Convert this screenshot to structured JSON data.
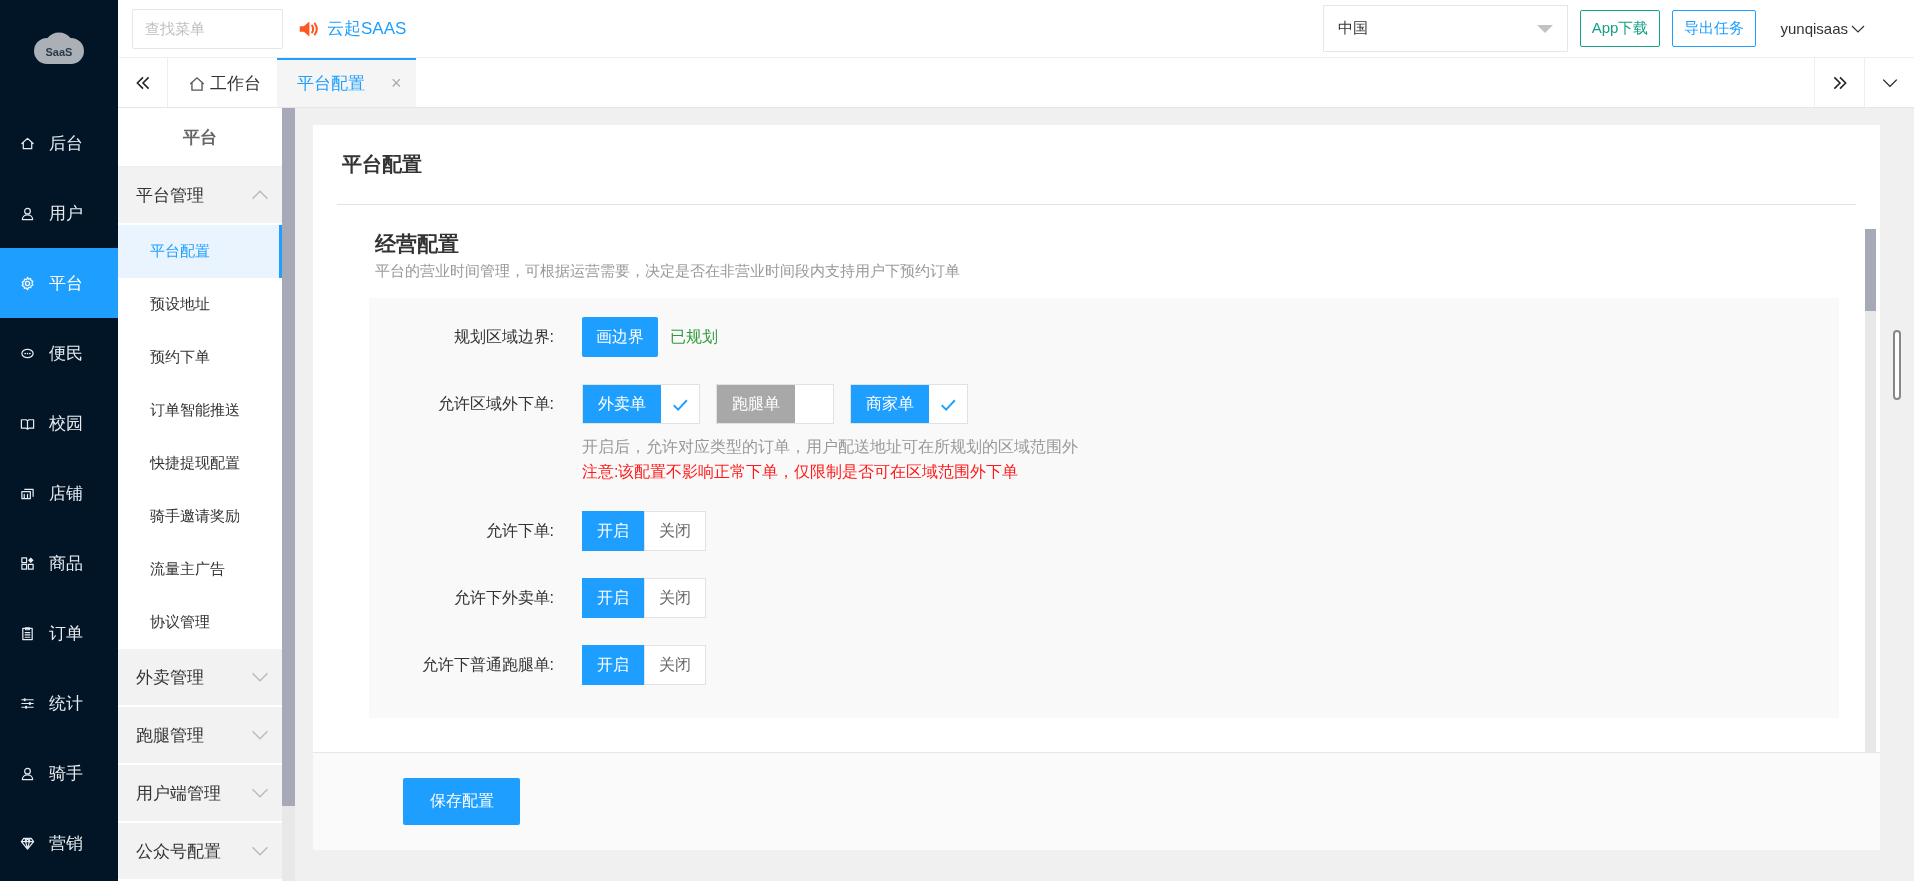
{
  "logo": {
    "text": "SaaS"
  },
  "nav": [
    {
      "label": "后台",
      "kind": "home",
      "selected": false
    },
    {
      "label": "用户",
      "kind": "user",
      "selected": false
    },
    {
      "label": "平台",
      "kind": "gear",
      "selected": true
    },
    {
      "label": "便民",
      "kind": "chat",
      "selected": false
    },
    {
      "label": "校园",
      "kind": "book",
      "selected": false
    },
    {
      "label": "店铺",
      "kind": "shop",
      "selected": false
    },
    {
      "label": "商品",
      "kind": "grid",
      "selected": false
    },
    {
      "label": "订单",
      "kind": "clipboard",
      "selected": false
    },
    {
      "label": "统计",
      "kind": "sliders",
      "selected": false
    },
    {
      "label": "骑手",
      "kind": "user",
      "selected": false
    },
    {
      "label": "营销",
      "kind": "diamond",
      "selected": false
    }
  ],
  "search": {
    "placeholder": "查找菜单"
  },
  "notice": "云起SAAS",
  "region_select": {
    "value": "中国"
  },
  "header_buttons": [
    {
      "label": "App下载",
      "kind": "green"
    },
    {
      "label": "导出任务",
      "kind": "blue"
    }
  ],
  "user": "yunqisaas",
  "tabs": [
    {
      "label": "工作台",
      "kind": "home",
      "selected": false
    },
    {
      "label": "平台配置",
      "kind": "page",
      "selected": true,
      "close": "×"
    }
  ],
  "submenu": {
    "title": "平台",
    "groups": [
      {
        "label": "平台管理",
        "expanded": true,
        "items": [
          {
            "label": "平台配置",
            "selected": true
          },
          {
            "label": "预设地址",
            "selected": false
          },
          {
            "label": "预约下单",
            "selected": false
          },
          {
            "label": "订单智能推送",
            "selected": false
          },
          {
            "label": "快捷提现配置",
            "selected": false
          },
          {
            "label": "骑手邀请奖励",
            "selected": false
          },
          {
            "label": "流量主广告",
            "selected": false
          },
          {
            "label": "协议管理",
            "selected": false
          }
        ]
      },
      {
        "label": "外卖管理",
        "expanded": false
      },
      {
        "label": "跑腿管理",
        "expanded": false
      },
      {
        "label": "用户端管理",
        "expanded": false
      },
      {
        "label": "公众号配置",
        "expanded": false
      }
    ]
  },
  "page": {
    "title": "平台配置",
    "section": {
      "title": "经营配置",
      "description": "平台的营业时间管理，可根据运营需要，决定是否在非营业时间段内支持用户下预约订单"
    },
    "fields": [
      {
        "kind": "boundary",
        "label": "规划区域边界:",
        "button": "画边界",
        "status": "已规划"
      },
      {
        "kind": "checks",
        "label": "允许区域外下单:",
        "options": [
          {
            "label": "外卖单",
            "checked": true
          },
          {
            "label": "跑腿单",
            "checked": false
          },
          {
            "label": "商家单",
            "checked": true
          }
        ],
        "hint": "开启后，允许对应类型的订单，用户配送地址可在所规划的区域范围外",
        "warning": "注意:该配置不影响正常下单，仅限制是否可在区域范围外下单"
      },
      {
        "kind": "toggle",
        "label": "允许下单:",
        "options": [
          {
            "label": "开启",
            "selected": true
          },
          {
            "label": "关闭",
            "selected": false
          }
        ]
      },
      {
        "kind": "toggle",
        "label": "允许下外卖单:",
        "options": [
          {
            "label": "开启",
            "selected": true
          },
          {
            "label": "关闭",
            "selected": false
          }
        ]
      },
      {
        "kind": "toggle",
        "label": "允许下普通跑腿单:",
        "options": [
          {
            "label": "开启",
            "selected": true
          },
          {
            "label": "关闭",
            "selected": false
          }
        ]
      }
    ],
    "save_button": "保存配置"
  }
}
